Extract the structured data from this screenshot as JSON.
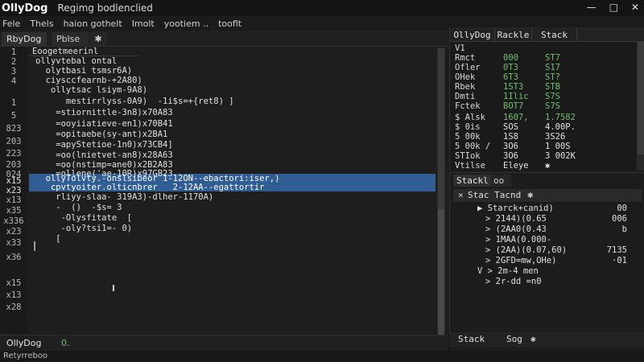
{
  "window": {
    "app_name": "OllyDog",
    "doc_title": "Regimg bodlenclied",
    "buttons": [
      "—",
      "□",
      "✕"
    ]
  },
  "menu": [
    "Fele",
    "Thels",
    "haion gothelt",
    "Imolt",
    "yootiem ..",
    "tooflt"
  ],
  "tabs": [
    "RbyDog",
    "Pblse",
    "✱"
  ],
  "code": {
    "header": "Eoogetmeerinl",
    "line_numbers": [
      "1",
      "2",
      "3",
      "4",
      "1",
      "5",
      "823",
      "203",
      "223",
      "203",
      "024",
      "x15",
      "x23",
      "x13",
      "x35",
      "x336",
      "x23",
      "x33",
      "x36",
      "x15",
      "x13",
      "x28"
    ],
    "lines": [
      "ollyvtebal ontal",
      "  olytbasi tsmsr6A)",
      "  ciysccfearnb-+2A80)",
      "   ollytsac lsiym-9A8)",
      "      mestirrlyss-0A9)  -1i$s=+{ret8) ]",
      "    =stiornittle-3n8)x70A83",
      "    =ooyiiatieve-en1)x70B41",
      "    =opitaebe(sy-ant)x2BA1",
      "    =apyStetioe-1n0)x73CB4]",
      "    =oo(lnietvet-an8)x28A63",
      "    =oo(nstimp=ane0)x2B2A83",
      "    =ollene('ae-10R)x97GB23",
      "  ollyTolvty.-onslsibeor 1-12ON--ebactori:iser,)",
      "   cpvtyoiter.olticnbrer   2-12AA--egattortir",
      "    rliyy-slaa- 319A3)-dlher-1170A)",
      "    -  ()  -$s= 3",
      "     -Olysfitate  [",
      "     -oly?tsi1=- 0)",
      "    [",
      "",
      "",
      ""
    ]
  },
  "registers": {
    "headers": [
      "OllyDog",
      "Rackle",
      "Stack"
    ],
    "rows": [
      {
        "name": "V1",
        "a": "",
        "b": ""
      },
      {
        "name": "Rmct",
        "a": "000",
        "b": "ST7"
      },
      {
        "name": "Ofler",
        "a": "0T3",
        "b": "S17"
      },
      {
        "name": "OHek",
        "a": "6T3",
        "b": "ST?"
      },
      {
        "name": "Rbek",
        "a": "1ST3",
        "b": "STB"
      },
      {
        "name": "Dmti",
        "a": "1Ilic",
        "b": "S7S"
      },
      {
        "name": "Fctek",
        "a": "BOT7",
        "b": "S7S"
      },
      {
        "name": "$ Alsk",
        "a": "1607,",
        "b": "1.7582"
      },
      {
        "name": "$ 0is",
        "a": "SOS",
        "b": "4.00P."
      },
      {
        "name": "5 00k",
        "a": "1S8",
        "b": "3S26"
      },
      {
        "name": "5 00k /",
        "a": "3O6",
        "b": "1 00S"
      },
      {
        "name": "STIok",
        "a": "3O6",
        "b": "3 002K"
      },
      {
        "name": "Vtilse",
        "a": "Eleye",
        "b": "✱"
      }
    ]
  },
  "stack": {
    "tabs": [
      "Stackl",
      "oo"
    ],
    "toolbar_title": "Stac Tacnd",
    "rows": [
      {
        "text": "▶ Starck+canid)",
        "val": "00"
      },
      {
        "text": "> 2144)(0.65",
        "val": "006"
      },
      {
        "text": "> (2AA0(0.43",
        "val": "b"
      },
      {
        "text": "> 1MAA(0.000-",
        "val": ""
      },
      {
        "text": "> (2AA)(0.07,60)",
        "val": "7135"
      },
      {
        "text": "> 2GFD=mw,OHe)",
        "val": "·01"
      },
      {
        "text": "V > 2m-4 men",
        "val": ""
      },
      {
        "text": "> 2r-dd =n0",
        "val": ""
      }
    ],
    "bottom": [
      "Stack",
      "Sog",
      "✱"
    ]
  },
  "status": {
    "left": "OllyDog",
    "right": "0."
  },
  "footer": "Retyrreboo"
}
